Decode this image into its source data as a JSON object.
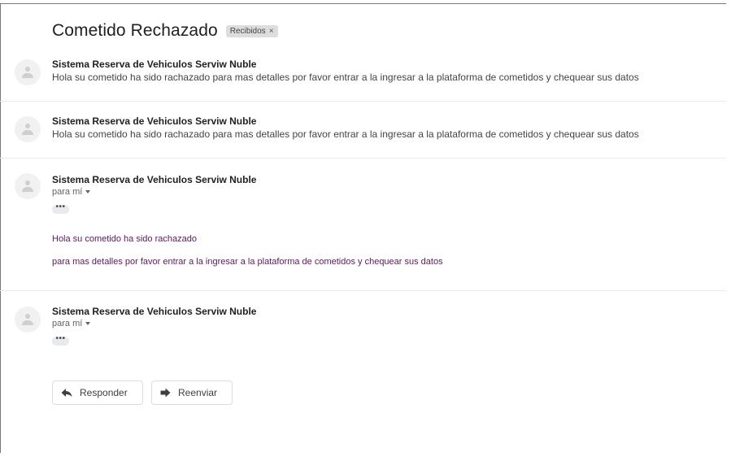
{
  "thread": {
    "subject": "Cometido Rechazado",
    "label": "Recibidos",
    "label_close": "×"
  },
  "messages": [
    {
      "sender": "Sistema Reserva de Vehiculos Serviw Nuble",
      "snippet": "Hola su cometido ha sido rachazado para mas detalles por favor entrar a la ingresar a la plataforma de cometidos y chequear sus datos"
    },
    {
      "sender": "Sistema Reserva de Vehiculos Serviw Nuble",
      "snippet": "Hola su cometido ha sido rachazado para mas detalles por favor entrar a la ingresar a la plataforma de cometidos y chequear sus datos"
    },
    {
      "sender": "Sistema Reserva de Vehiculos Serviw Nuble",
      "recipient": "para mí",
      "dots": "•••",
      "body_line1": "Hola su cometido ha sido rachazado",
      "body_line2": "para mas detalles por favor entrar a la ingresar a la plataforma de cometidos y chequear sus datos"
    },
    {
      "sender": "Sistema Reserva de Vehiculos Serviw Nuble",
      "recipient": "para mí",
      "dots": "•••"
    }
  ],
  "actions": {
    "reply_label": "Responder",
    "forward_label": "Reenviar"
  },
  "icons": {
    "avatar": "default-avatar-icon",
    "reply": "reply-arrow-icon",
    "forward": "forward-arrow-icon",
    "caret": "caret-down-icon"
  }
}
